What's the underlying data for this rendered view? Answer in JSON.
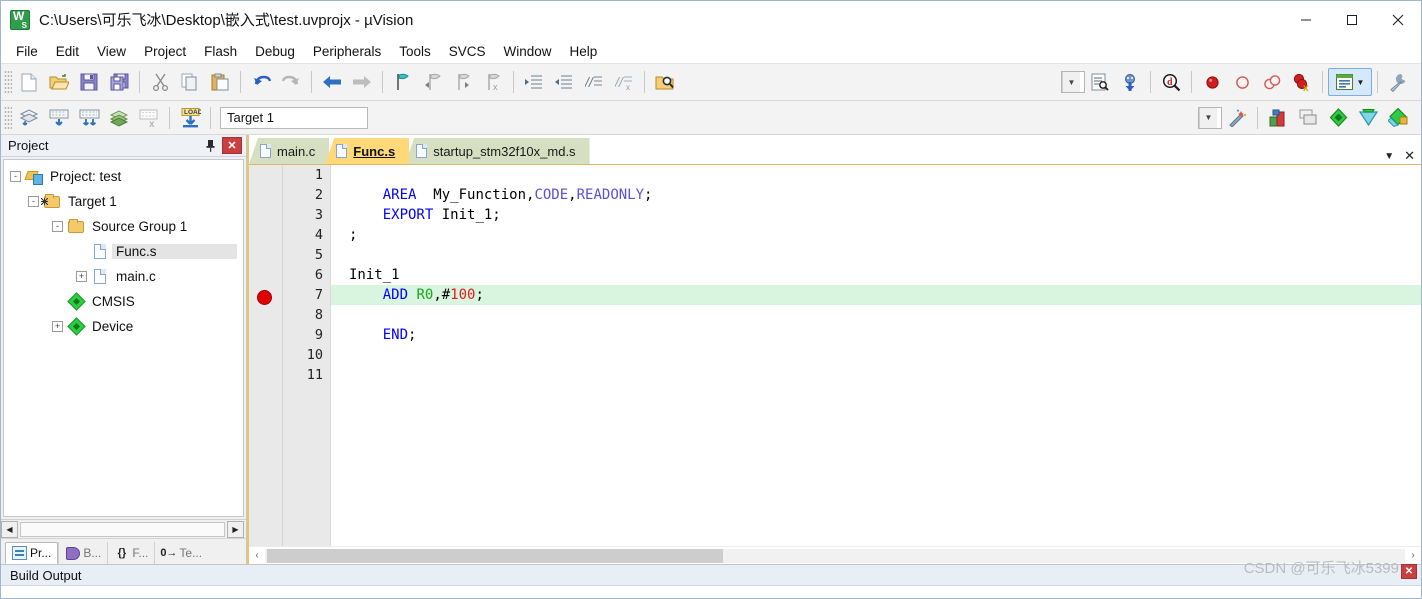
{
  "window": {
    "title": "C:\\Users\\可乐飞冰\\Desktop\\嵌入式\\test.uvprojx - µVision",
    "app_icon": "uvision-icon",
    "minimize": "—",
    "maximize": "□",
    "close": "✕"
  },
  "menubar": {
    "items": [
      {
        "label": "File"
      },
      {
        "label": "Edit"
      },
      {
        "label": "View"
      },
      {
        "label": "Project"
      },
      {
        "label": "Flash"
      },
      {
        "label": "Debug"
      },
      {
        "label": "Peripherals"
      },
      {
        "label": "Tools"
      },
      {
        "label": "SVCS"
      },
      {
        "label": "Window"
      },
      {
        "label": "Help"
      }
    ]
  },
  "toolbar_main": {
    "buttons": [
      {
        "name": "new-file-icon",
        "title": "New"
      },
      {
        "name": "open-file-icon",
        "title": "Open"
      },
      {
        "name": "save-icon",
        "title": "Save"
      },
      {
        "name": "save-all-icon",
        "title": "Save All"
      },
      {
        "name": "cut-icon",
        "title": "Cut"
      },
      {
        "name": "copy-icon",
        "title": "Copy"
      },
      {
        "name": "paste-icon",
        "title": "Paste"
      },
      {
        "name": "undo-icon",
        "title": "Undo"
      },
      {
        "name": "redo-icon",
        "title": "Redo"
      },
      {
        "name": "navigate-back-icon",
        "title": "Back"
      },
      {
        "name": "navigate-forward-icon",
        "title": "Forward"
      },
      {
        "name": "bookmark-toggle-icon",
        "title": "Insert/Remove Bookmark"
      },
      {
        "name": "bookmark-prev-icon",
        "title": "Previous Bookmark"
      },
      {
        "name": "bookmark-next-icon",
        "title": "Next Bookmark"
      },
      {
        "name": "bookmark-clear-icon",
        "title": "Clear All Bookmarks"
      },
      {
        "name": "indent-right-icon",
        "title": "Indent"
      },
      {
        "name": "indent-left-icon",
        "title": "Outdent"
      },
      {
        "name": "comment-icon",
        "title": "Comment"
      },
      {
        "name": "uncomment-icon",
        "title": "Uncomment"
      },
      {
        "name": "find-in-files-icon",
        "title": "Find in Files"
      }
    ],
    "search_combo_value": "",
    "right_buttons": [
      {
        "name": "find-next-icon",
        "title": "Find Next"
      },
      {
        "name": "start-debug-icon",
        "title": "Start/Stop Debug Session"
      },
      {
        "name": "magnify-icon",
        "title": "Debug Window"
      },
      {
        "name": "breakpoint-insert-icon",
        "title": "Insert/Remove Breakpoint"
      },
      {
        "name": "breakpoint-enable-icon",
        "title": "Enable/Disable Breakpoint"
      },
      {
        "name": "breakpoint-disable-all-icon",
        "title": "Disable All Breakpoints"
      },
      {
        "name": "breakpoint-kill-all-icon",
        "title": "Kill All Breakpoints"
      },
      {
        "name": "manage-windows-icon",
        "title": "Manage Windows"
      },
      {
        "name": "configure-icon",
        "title": "Configure"
      }
    ]
  },
  "toolbar_build": {
    "buttons": [
      {
        "name": "translate-icon",
        "title": "Translate"
      },
      {
        "name": "build-icon",
        "title": "Build"
      },
      {
        "name": "rebuild-icon",
        "title": "Rebuild"
      },
      {
        "name": "batch-build-icon",
        "title": "Batch Build"
      },
      {
        "name": "stop-build-icon",
        "title": "Stop Build"
      },
      {
        "name": "download-icon",
        "title": "Download"
      }
    ],
    "target": "Target 1",
    "right_buttons": [
      {
        "name": "target-options-icon",
        "title": "Options for Target"
      },
      {
        "name": "manage-project-items-icon",
        "title": "Manage Project Items"
      },
      {
        "name": "components-icon",
        "title": "Run-Time Environment"
      },
      {
        "name": "pack-installer-icon",
        "title": "Pack Installer"
      },
      {
        "name": "multi-project-icon",
        "title": "Manage Multi-Project"
      }
    ]
  },
  "project_panel": {
    "title": "Project",
    "pin_icon": "pin-icon",
    "close_icon": "close-icon",
    "tree": [
      {
        "label": "Project: test",
        "icon": "project-icon",
        "expander": "-",
        "depth": 0,
        "selected": false
      },
      {
        "label": "Target 1",
        "icon": "target-folder-icon",
        "expander": "-",
        "depth": 1,
        "selected": false
      },
      {
        "label": "Source Group 1",
        "icon": "folder-icon",
        "expander": "-",
        "depth": 2,
        "selected": false
      },
      {
        "label": "Func.s",
        "icon": "file-icon",
        "expander": "",
        "depth": 3,
        "selected": true
      },
      {
        "label": "main.c",
        "icon": "file-icon",
        "expander": "+",
        "depth": 3,
        "selected": false
      },
      {
        "label": "CMSIS",
        "icon": "component-icon",
        "expander": "",
        "depth": 2,
        "selected": false
      },
      {
        "label": "Device",
        "icon": "component-icon",
        "expander": "+",
        "depth": 2,
        "selected": false
      }
    ],
    "bottom_tabs": [
      {
        "label": "Pr...",
        "icon": "project-window-icon",
        "active": true
      },
      {
        "label": "B...",
        "icon": "books-icon",
        "active": false
      },
      {
        "label": "F...",
        "icon": "functions-icon",
        "active": false
      },
      {
        "label": "Te...",
        "icon": "templates-icon",
        "active": false
      }
    ],
    "bottom_tab_icon_text": {
      "functions": "{}",
      "templates": "0"
    }
  },
  "editor": {
    "tabs": [
      {
        "label": "main.c",
        "active": false
      },
      {
        "label": "Func.s",
        "active": true
      },
      {
        "label": "startup_stm32f10x_md.s",
        "active": false
      }
    ],
    "tabbar_dropdown_icon": "chevron-down-icon",
    "tabbar_close_icon": "close-icon",
    "line_numbers": [
      "1",
      "2",
      "3",
      "4",
      "5",
      "6",
      "7",
      "8",
      "9",
      "10",
      "11"
    ],
    "breakpoint_line": 7,
    "current_line": 7,
    "lines": [
      {
        "n": 1,
        "tokens": []
      },
      {
        "n": 2,
        "tokens": [
          {
            "t": "    ",
            "c": "pl"
          },
          {
            "t": "AREA",
            "c": "k"
          },
          {
            "t": "  My_Function,",
            "c": "pl"
          },
          {
            "t": "CODE",
            "c": "kp"
          },
          {
            "t": ",",
            "c": "pl"
          },
          {
            "t": "READONLY",
            "c": "kp"
          },
          {
            "t": ";",
            "c": "pl"
          }
        ]
      },
      {
        "n": 3,
        "tokens": [
          {
            "t": "    ",
            "c": "pl"
          },
          {
            "t": "EXPORT",
            "c": "k"
          },
          {
            "t": " Init_1;",
            "c": "pl"
          }
        ]
      },
      {
        "n": 4,
        "tokens": [
          {
            "t": ";",
            "c": "pl"
          }
        ]
      },
      {
        "n": 5,
        "tokens": []
      },
      {
        "n": 6,
        "tokens": [
          {
            "t": "Init_1",
            "c": "pl"
          }
        ]
      },
      {
        "n": 7,
        "tokens": [
          {
            "t": "    ",
            "c": "pl"
          },
          {
            "t": "ADD",
            "c": "k"
          },
          {
            "t": " ",
            "c": "pl"
          },
          {
            "t": "R0",
            "c": "reg"
          },
          {
            "t": ",#",
            "c": "pl"
          },
          {
            "t": "100",
            "c": "num"
          },
          {
            "t": ";",
            "c": "pl"
          }
        ]
      },
      {
        "n": 8,
        "tokens": []
      },
      {
        "n": 9,
        "tokens": [
          {
            "t": "    ",
            "c": "pl"
          },
          {
            "t": "END",
            "c": "k"
          },
          {
            "t": ";",
            "c": "pl"
          }
        ]
      },
      {
        "n": 10,
        "tokens": []
      },
      {
        "n": 11,
        "tokens": []
      }
    ],
    "hscroll_left_icon": "‹",
    "hscroll_right_icon": "›",
    "hscroll_thumb_percent": 40
  },
  "build_output": {
    "title": "Build Output"
  },
  "watermark": {
    "text": "CSDN @可乐飞冰5399"
  },
  "colors": {
    "accent_tab": "#ffd979",
    "tab_inactive": "#d7dfc2",
    "keyword": "#0000ff",
    "directive": "#5a50d8",
    "register": "#19a519",
    "number": "#e01b1b",
    "current_line": "#d9f5df",
    "breakpoint": "#e00000",
    "panel_close": "#c94040"
  }
}
